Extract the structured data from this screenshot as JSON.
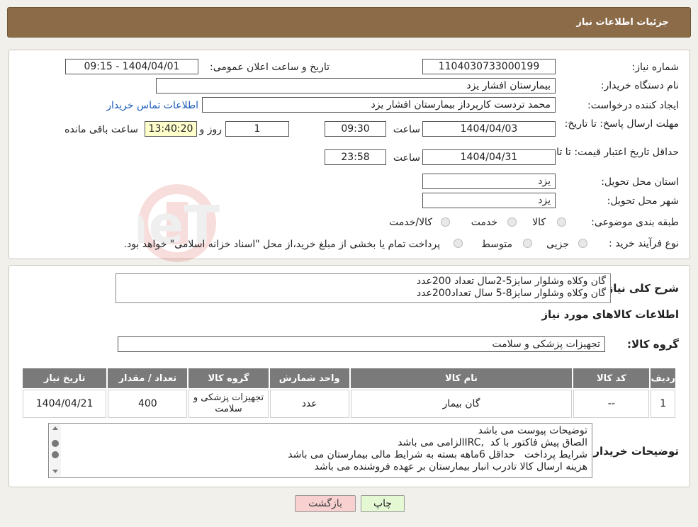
{
  "header": {
    "title": "جزئیات اطلاعات نیاز"
  },
  "fields": {
    "need_number_label": "شماره نیاز:",
    "need_number": "1104030733000199",
    "announce_label": "تاریخ و ساعت اعلان عمومی:",
    "announce_value": "1404/04/01 - 09:15",
    "buyer_org_label": "نام دستگاه خریدار:",
    "buyer_org": "بیمارستان افشار یزد",
    "creator_label": "ایجاد کننده درخواست:",
    "creator": "محمد تردست کارپرداز بیمارستان افشار یزد",
    "contact_link": "اطلاعات تماس خریدار",
    "reply_deadline_label": "مهلت ارسال پاسخ: تا تاریخ:",
    "reply_date": "1404/04/03",
    "time_label": "ساعت",
    "reply_time": "09:30",
    "days_value": "1",
    "days_label": "روز و",
    "remaining_time": "13:40:20",
    "remaining_label": "ساعت باقی مانده",
    "validity_label": "حداقل تاریخ اعتبار قیمت: تا تاریخ:",
    "validity_date": "1404/04/31",
    "validity_time": "23:58",
    "province_label": "استان محل تحویل:",
    "province": "یزد",
    "city_label": "شهر محل تحویل:",
    "city": "یزد",
    "category_label": "طبقه بندی موضوعی:",
    "category_options": [
      "کالا",
      "خدمت",
      "کالا/خدمت"
    ],
    "purchase_type_label": "نوع فرآیند خرید :",
    "purchase_options": [
      "جزیی",
      "متوسط"
    ],
    "purchase_note": "پرداخت تمام یا بخشی از مبلغ خرید،از محل \"اسناد خزانه اسلامی\" خواهد بود."
  },
  "description": {
    "label": "شرح کلی نیاز:",
    "text": "گان وکلاه وشلوار سایز5-2سال تعداد 200عدد\nگان وکلاه وشلوار سایز8-5 سال تعداد200عدد"
  },
  "goods": {
    "section_title": "اطلاعات کالاهای مورد نیاز",
    "group_label": "گروه کالا:",
    "group_value": "تجهیزات پزشکی و سلامت",
    "columns": [
      "ردیف",
      "کد کالا",
      "نام کالا",
      "واحد شمارش",
      "گروه کالا",
      "تعداد / مقدار",
      "تاریخ نیاز"
    ],
    "rows": [
      {
        "row": "1",
        "code": "--",
        "name": "گان بیمار",
        "unit": "عدد",
        "group": "تجهیزات پزشکی و سلامت",
        "qty": "400",
        "date": "1404/04/21"
      }
    ]
  },
  "buyer_notes": {
    "label": "توضیحات خریدار:",
    "text": "توضیحات پیوست می باشد\nالصاق پیش فاکتور با کد  ,IRCالزامی می باشد\nشرایط پرداخت   حداقل 6ماهه بسته به شرایط مالی بیمارستان می باشد\nهزینه ارسال کالا تادرب انبار بیمارستان بر عهده فروشنده می باشد"
  },
  "buttons": {
    "print": "چاپ",
    "back": "بازگشت"
  },
  "watermark": {
    "text": "AriaTender.neT"
  },
  "colors": {
    "title_bg": "#8b6b48",
    "table_header": "#7a7a7a",
    "link": "#1a5bb8",
    "back_btn": "#f8d0d0",
    "print_btn": "#e4f8d4"
  }
}
